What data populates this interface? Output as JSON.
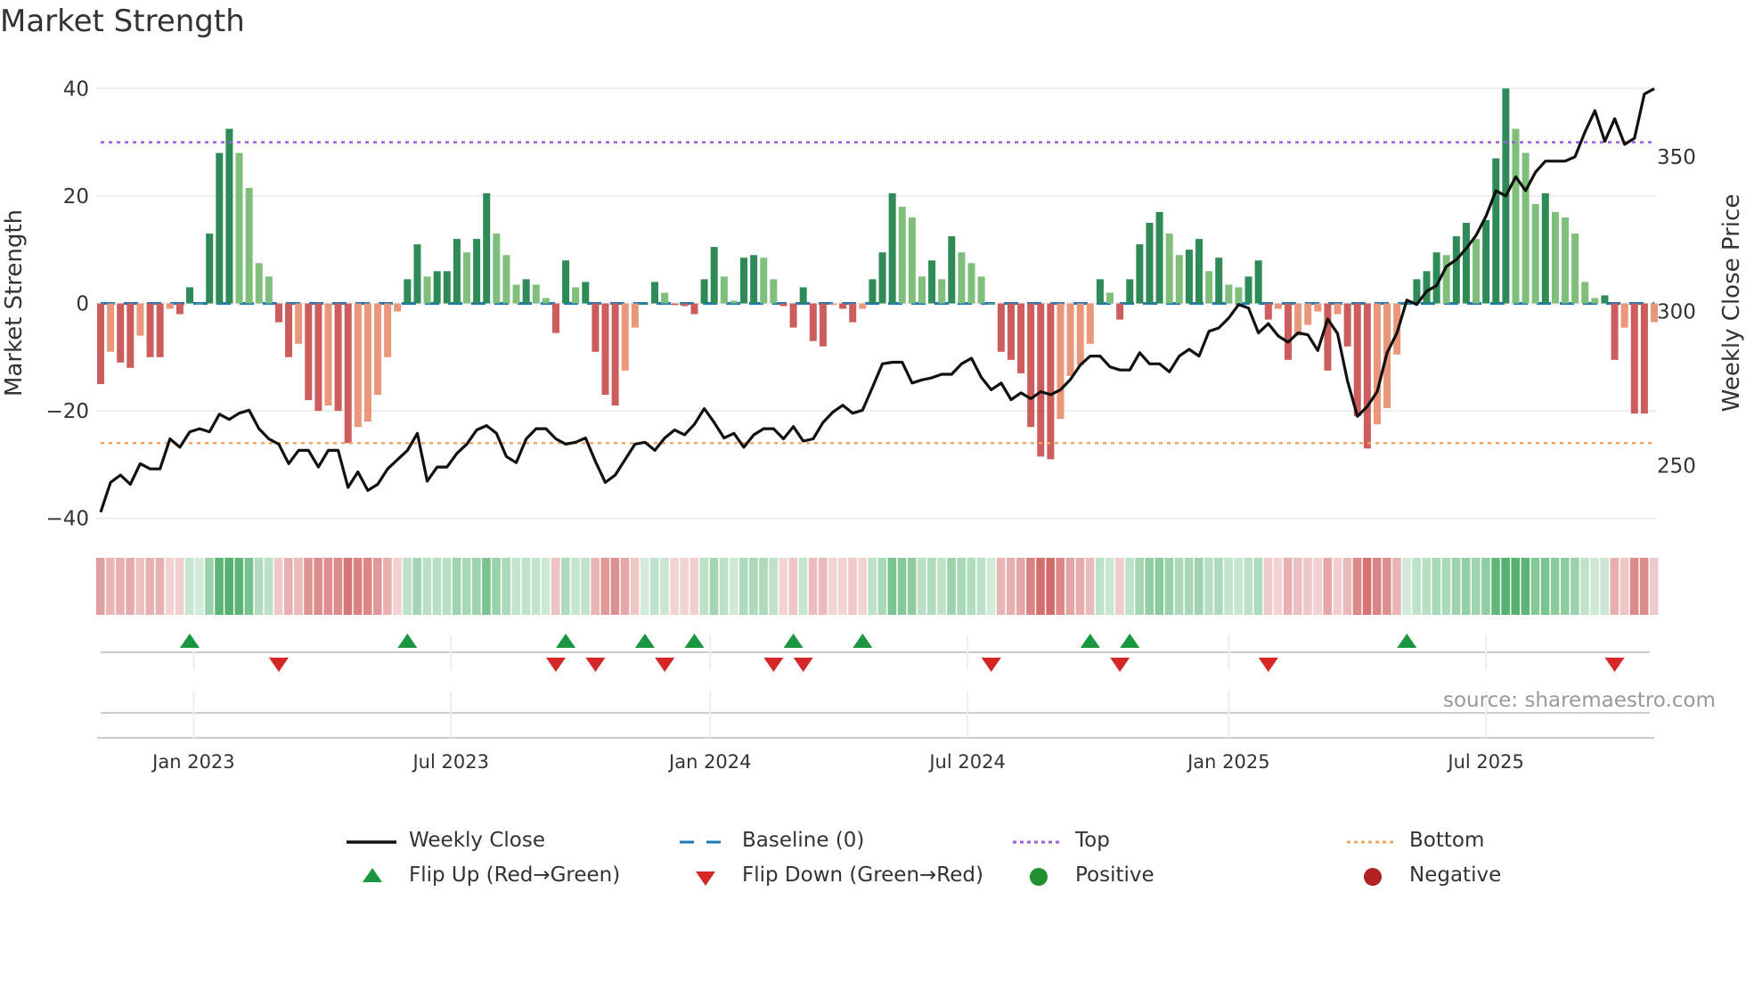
{
  "title": "Market Strength",
  "source": "source: sharemaestro.com",
  "colors": {
    "pos_up": "#2e8b57",
    "pos_down": "#7fbf7b",
    "neg_down": "#cd5c5c",
    "neg_up": "#e9967a",
    "baseline": "#1f77b4",
    "top": "#9b5de5",
    "bottom": "#f4a460",
    "close": "#111111",
    "flip_up": "#1a9641",
    "flip_down": "#d62728",
    "positive": "#1f8f2f",
    "negative": "#b22222"
  },
  "legend": [
    {
      "label": "Weekly Close",
      "marker": "line"
    },
    {
      "label": "Baseline (0)",
      "marker": "dash"
    },
    {
      "label": "Top",
      "marker": "dot-purple"
    },
    {
      "label": "Bottom",
      "marker": "dot-orange"
    },
    {
      "label": "Flip Up (Red→Green)",
      "marker": "triangle-up"
    },
    {
      "label": "Flip Down (Green→Red)",
      "marker": "triangle-down"
    },
    {
      "label": "Positive",
      "marker": "circle-green"
    },
    {
      "label": "Negative",
      "marker": "circle-red"
    }
  ],
  "chart_data": {
    "type": "bar",
    "title": "Market Strength",
    "frequency": "weekly",
    "ylabel": "Market Strength",
    "ylabel_right": "Weekly Close Price",
    "ylim": [
      -42,
      42
    ],
    "yticks": [
      40,
      20,
      0,
      -20,
      -40
    ],
    "ylim_right": [
      228,
      378
    ],
    "yticks_right": [
      350,
      300,
      250
    ],
    "top_level": 30,
    "bottom_level": -26,
    "baseline": 0,
    "xticks": [
      {
        "label": "Jan 2023",
        "week": 9.4
      },
      {
        "label": "Jul 2023",
        "week": 35.4
      },
      {
        "label": "Jan 2024",
        "week": 61.6
      },
      {
        "label": "Jul 2024",
        "week": 87.6
      },
      {
        "label": "Jan 2025",
        "week": 114
      },
      {
        "label": "Jul 2025",
        "week": 140
      }
    ],
    "strength": [
      -15,
      -9,
      -11,
      -12,
      -6,
      -10,
      -10,
      -1,
      -2,
      3,
      0,
      13,
      28,
      32.5,
      28,
      21.5,
      7.5,
      5,
      -3.5,
      -10,
      -7.5,
      -18,
      -20,
      -19,
      -20,
      -26,
      -23,
      -22,
      -17,
      -10,
      -1.5,
      4.5,
      11,
      5,
      6,
      6,
      12,
      9.5,
      12,
      20.5,
      13,
      9,
      3.5,
      4.5,
      3.5,
      1,
      -5.5,
      8,
      3,
      4,
      -9,
      -17,
      -19,
      -12.5,
      -4.5,
      0,
      4,
      2,
      -0.3,
      -0.5,
      -2,
      4.5,
      10.5,
      5,
      0.5,
      8.5,
      9,
      8.5,
      4.5,
      -0.5,
      -4.5,
      3,
      -7,
      -8,
      -0.3,
      -1,
      -3.5,
      -1,
      4.5,
      9.5,
      20.5,
      18,
      16,
      5,
      8,
      4.5,
      12.5,
      9.5,
      7.5,
      5,
      0,
      -9,
      -10.5,
      -13,
      -23,
      -28.5,
      -29,
      -21.5,
      -13.5,
      -11.5,
      -7.5,
      4.5,
      2,
      -3,
      4.5,
      11,
      15,
      17,
      13,
      9,
      10,
      12,
      6,
      8.5,
      3.5,
      3,
      5,
      8,
      -3,
      -1,
      -10.5,
      -6,
      -4,
      -1.5,
      -12.5,
      -2,
      -8,
      -21,
      -27,
      -22.5,
      -19.5,
      -9.5,
      0,
      4.5,
      6,
      9.5,
      9,
      12.5,
      15,
      12,
      15.5,
      27,
      40,
      32.5,
      28,
      18.5,
      20.5,
      17,
      16,
      13,
      4,
      1,
      1.5,
      -10.5,
      -4.5,
      -20.5,
      -20.5,
      -3.5
    ],
    "weekly_close": [
      235,
      244.6,
      247,
      244,
      250.7,
      249,
      249,
      258.7,
      256,
      261,
      262,
      261,
      266.7,
      265,
      267,
      268,
      262,
      258.7,
      257,
      250.7,
      255,
      255,
      249.6,
      255,
      255,
      243,
      248,
      242,
      244,
      249,
      252,
      255,
      260.5,
      245,
      249.6,
      249.6,
      254,
      257,
      261.6,
      263,
      260.5,
      253,
      251,
      258.7,
      262,
      262,
      258.7,
      257,
      257.6,
      259,
      251.4,
      244.6,
      247,
      252,
      257,
      257.6,
      255,
      259,
      261.6,
      260,
      263.4,
      268.5,
      264,
      259,
      260.5,
      256,
      260,
      262,
      262,
      258.7,
      262.7,
      258,
      258.7,
      264,
      267.4,
      269.6,
      267,
      268,
      275.4,
      283,
      283.5,
      283.5,
      276.8,
      277.8,
      278.5,
      279.6,
      279.6,
      283,
      284.8,
      278.6,
      274.6,
      276.8,
      271.4,
      273.6,
      271.7,
      274,
      273,
      274.6,
      277.9,
      282.6,
      285.5,
      285.5,
      282,
      281,
      281,
      286.6,
      283,
      283,
      280.4,
      285.5,
      287.7,
      285.5,
      293.5,
      294.6,
      297.8,
      302.2,
      301,
      293,
      296,
      292,
      290,
      293,
      292.4,
      287.3,
      297.5,
      292.8,
      277.5,
      266,
      269.2,
      274,
      286.6,
      293,
      303.6,
      302.2,
      306.5,
      308.3,
      314.5,
      316.7,
      320.3,
      324.6,
      330.8,
      339,
      337.3,
      343.5,
      339,
      345,
      348.6,
      348.6,
      348.6,
      350,
      358,
      364.9,
      355,
      362.3,
      354,
      356,
      370.3,
      372
    ],
    "flip_up_weeks": [
      9,
      31,
      47,
      55,
      60,
      70,
      77,
      100,
      104,
      132
    ],
    "flip_down_weeks": [
      18,
      46,
      50,
      57,
      68,
      71,
      90,
      103,
      118,
      153
    ]
  }
}
